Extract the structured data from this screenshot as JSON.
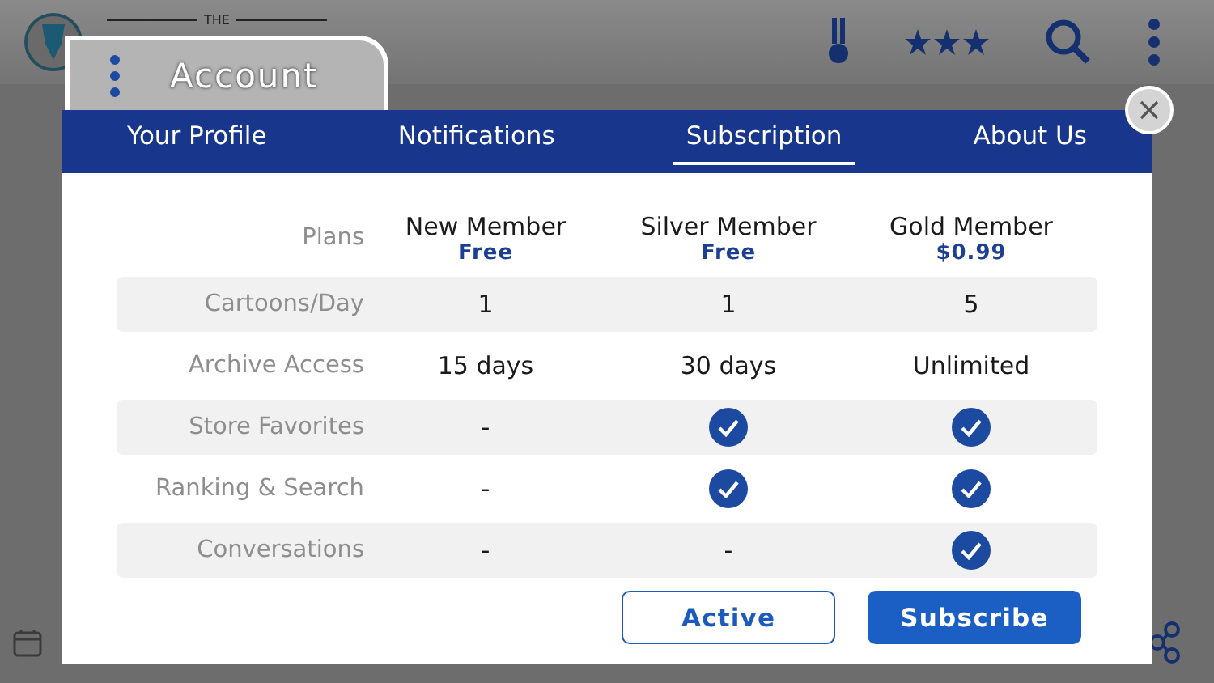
{
  "background": {
    "masthead": "THE"
  },
  "dialog": {
    "title": "Account",
    "tabs": [
      {
        "label": "Your Profile",
        "selected": false
      },
      {
        "label": "Notifications",
        "selected": false
      },
      {
        "label": "Subscription",
        "selected": true
      },
      {
        "label": "About Us",
        "selected": false
      }
    ],
    "plans": [
      {
        "name": "New Member",
        "price": "Free"
      },
      {
        "name": "Silver Member",
        "price": "Free"
      },
      {
        "name": "Gold Member",
        "price": "$0.99"
      }
    ],
    "plans_label": "Plans",
    "features": [
      {
        "label": "Cartoons/Day",
        "cells": [
          {
            "kind": "text",
            "text": "1"
          },
          {
            "kind": "text",
            "text": "1"
          },
          {
            "kind": "text",
            "text": "5"
          }
        ]
      },
      {
        "label": "Archive Access",
        "cells": [
          {
            "kind": "text",
            "text": "15 days"
          },
          {
            "kind": "text",
            "text": "30 days"
          },
          {
            "kind": "text",
            "text": "Unlimited"
          }
        ]
      },
      {
        "label": "Store Favorites",
        "cells": [
          {
            "kind": "text",
            "text": "-"
          },
          {
            "kind": "check"
          },
          {
            "kind": "check"
          }
        ]
      },
      {
        "label": "Ranking & Search",
        "cells": [
          {
            "kind": "text",
            "text": "-"
          },
          {
            "kind": "check"
          },
          {
            "kind": "check"
          }
        ]
      },
      {
        "label": "Conversations",
        "cells": [
          {
            "kind": "text",
            "text": "-"
          },
          {
            "kind": "text",
            "text": "-"
          },
          {
            "kind": "check"
          }
        ]
      }
    ],
    "buttons": [
      {
        "label": "Active",
        "kind": "outline"
      },
      {
        "label": "Subscribe",
        "kind": "primary"
      }
    ]
  }
}
